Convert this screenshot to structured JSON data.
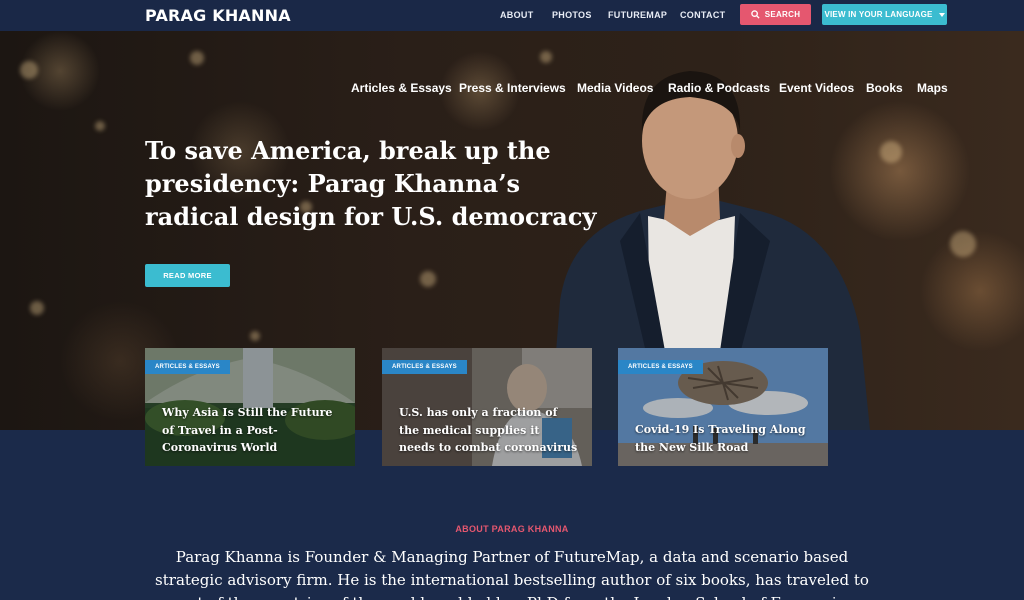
{
  "header": {
    "logo": "PARAG KHANNA",
    "nav": [
      "ABOUT",
      "PHOTOS",
      "FUTUREMAP",
      "CONTACT"
    ],
    "search_label": "SEARCH",
    "language_label": "VIEW IN YOUR LANGUAGE"
  },
  "categories": [
    "Articles & Essays",
    "Press & Interviews",
    "Media Videos",
    "Radio & Podcasts",
    "Event Videos",
    "Books",
    "Maps"
  ],
  "hero": {
    "headline": "To save America, break up the presidency: Parag Khanna’s radical design for U.S. democracy",
    "cta": "READ MORE"
  },
  "cards": [
    {
      "tag": "ARTICLES & ESSAYS",
      "title": "Why Asia Is Still the Future of Travel in a Post-Coronavirus World"
    },
    {
      "tag": "ARTICLES & ESSAYS",
      "title": "U.S. has only a fraction of the medical supplies it needs to combat coronavirus"
    },
    {
      "tag": "ARTICLES & ESSAYS",
      "title": "Covid-19 Is Traveling Along the New Silk Road"
    }
  ],
  "about": {
    "label": "ABOUT PARAG KHANNA",
    "text": "Parag Khanna is Founder & Managing Partner of FutureMap, a data and scenario based strategic advisory firm. He is the international bestselling author of six books, has traveled to most of the countries of the world, and holds a PhD from the London School of Economics."
  },
  "colors": {
    "navy": "#1a2847",
    "teal": "#3bbcd0",
    "pink": "#e5576f",
    "tag_blue": "#2a86c7"
  }
}
